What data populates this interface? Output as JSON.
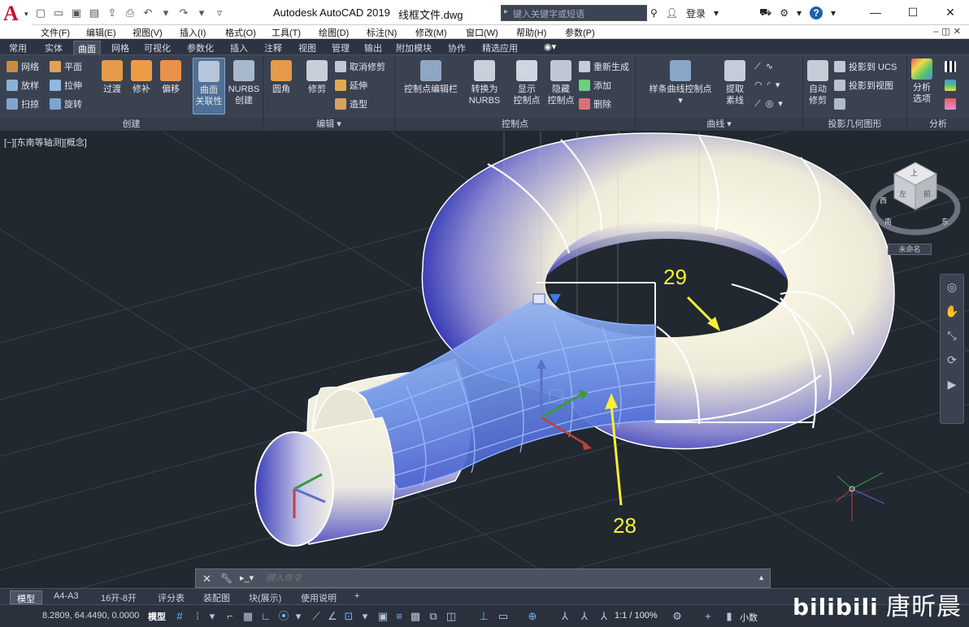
{
  "titlebar": {
    "app_title": "Autodesk AutoCAD 2019",
    "file_name": "线框文件.dwg",
    "search_placeholder": "键入关键字或短语",
    "login_label": "登录",
    "help_label": "?"
  },
  "menubar": [
    "文件(F)",
    "编辑(E)",
    "视图(V)",
    "插入(I)",
    "格式(O)",
    "工具(T)",
    "绘图(D)",
    "标注(N)",
    "修改(M)",
    "窗口(W)",
    "帮助(H)",
    "参数(P)"
  ],
  "ribbon_tabs": [
    "常用",
    "实体",
    "曲面",
    "网格",
    "可视化",
    "参数化",
    "插入",
    "注释",
    "视图",
    "管理",
    "输出",
    "附加模块",
    "协作",
    "精选应用"
  ],
  "active_tab": "曲面",
  "ribbon": {
    "create": {
      "title": "创建",
      "small_left": [
        "网络",
        "放样",
        "扫掠"
      ],
      "small_right": [
        "平面",
        "拉伸",
        "旋转"
      ],
      "big": [
        "过渡",
        "修补",
        "偏移"
      ],
      "assoc_1": "曲面",
      "assoc_2": "关联性",
      "nurbs_1": "NURBS",
      "nurbs_2": "创建"
    },
    "edit": {
      "title": "编辑",
      "fillet": "圆角",
      "trim": "修剪",
      "small": [
        "取消修剪",
        "延伸",
        "造型"
      ]
    },
    "cv_bar": {
      "label": "控制点编辑栏"
    },
    "control_points": {
      "title": "控制点",
      "convert_1": "转换为",
      "convert_2": "NURBS",
      "show_1": "显示",
      "show_2": "控制点",
      "hide_1": "隐藏",
      "hide_2": "控制点",
      "small": [
        "重新生成",
        "添加",
        "删除"
      ]
    },
    "curves": {
      "title": "曲线",
      "spline_cv": "样条曲线控制点",
      "extract_1": "提取",
      "extract_2": "素线"
    },
    "project": {
      "title": "投影几何图形",
      "auto_1": "自动",
      "auto_2": "修剪",
      "small": [
        "投影到 UCS",
        "投影到视图"
      ]
    },
    "analysis": {
      "title": "分析",
      "options_1": "分析",
      "options_2": "选项"
    }
  },
  "viewport": {
    "label": "[−][东南等轴测][概念]"
  },
  "viewcube": {
    "top": "上",
    "left": "左",
    "front": "前",
    "south": "南",
    "east": "东",
    "west": "西",
    "wcs": "未命名"
  },
  "annotations": {
    "a29": "29",
    "a28": "28"
  },
  "cmdline": {
    "placeholder": "键入命令"
  },
  "layout_tabs": [
    "模型",
    "A4-A3",
    "16开-8开",
    "评分表",
    "装配图",
    "块(展示)",
    "使用说明"
  ],
  "statusbar": {
    "coords": "8.2809, 64.4490, 0.0000",
    "model": "模型",
    "scale": "1:1 / 100%",
    "units": "小数"
  },
  "watermark": {
    "brand": "bilibili",
    "author": "唐昕晨"
  },
  "colors": {
    "accent": "#5b8fd6",
    "annotation": "#f8ef3a",
    "surface": "#f4f0dd",
    "shade": "#3f42b8"
  }
}
